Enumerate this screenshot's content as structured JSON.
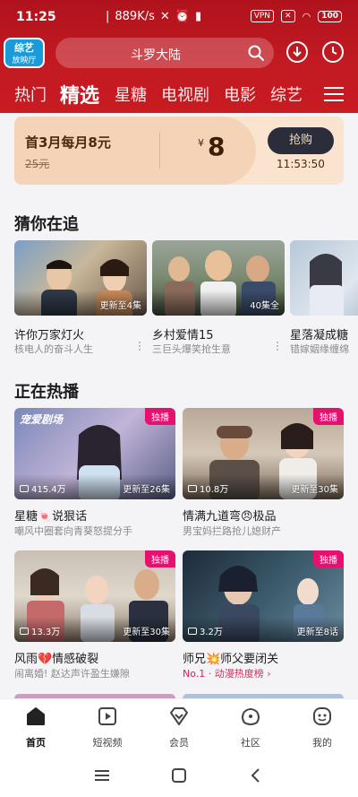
{
  "status_bar": {
    "time": "11:25",
    "speed": "889K/s",
    "vpn": "VPN",
    "battery": "100"
  },
  "header": {
    "logo_line1": "综艺",
    "logo_line2": "放映厅",
    "search_text": "斗罗大陆",
    "tabs": [
      "热门",
      "精选",
      "星糖",
      "电视剧",
      "电影",
      "综艺"
    ],
    "active_tab": "精选"
  },
  "promo": {
    "title": "首3月每月8元",
    "old_price": "25元",
    "currency": "¥",
    "price": "8",
    "button": "抢购",
    "countdown": "11:53:50"
  },
  "section_guess": {
    "title": "猜你在追",
    "items": [
      {
        "title": "许你万家灯火",
        "subtitle": "核电人的奋斗人生",
        "badge": "更新至4集"
      },
      {
        "title": "乡村爱情15",
        "subtitle": "三巨头爆笑抢生意",
        "badge": "40集全"
      },
      {
        "title": "星落凝成糖",
        "subtitle": "错嫁姻缘缠绵",
        "badge": ""
      }
    ]
  },
  "section_hot": {
    "title": "正在热播",
    "items": [
      {
        "title": "星糖🍬说狠话",
        "subtitle": "嘲风中圈套向青葵怒提分手",
        "views": "415.4万",
        "badge": "更新至26集",
        "tag": "独播",
        "overlay": "宠爱剧场"
      },
      {
        "title": "情满九道弯😠极品",
        "subtitle": "男宝妈拦路抢儿媳财产",
        "views": "10.8万",
        "badge": "更新至30集",
        "tag": "独播"
      },
      {
        "title": "风雨💔情感破裂",
        "subtitle": "闹离婚! 赵达声许盈生嫌隙",
        "views": "13.3万",
        "badge": "更新至30集",
        "tag": "独播"
      },
      {
        "title": "师兄💥师父要闭关",
        "rank_prefix": "No.1",
        "rank_text": "· 动漫热度榜 ›",
        "views": "3.2万",
        "badge": "更新至8话",
        "tag": "独播"
      }
    ]
  },
  "bottom_nav": {
    "items": [
      "首页",
      "短视频",
      "会员",
      "社区",
      "我的"
    ],
    "active": "首页"
  },
  "colors": {
    "header_red": "#c41a22",
    "exclusive_pink": "#e6106e",
    "promo_bg": "#fbe4cf"
  }
}
